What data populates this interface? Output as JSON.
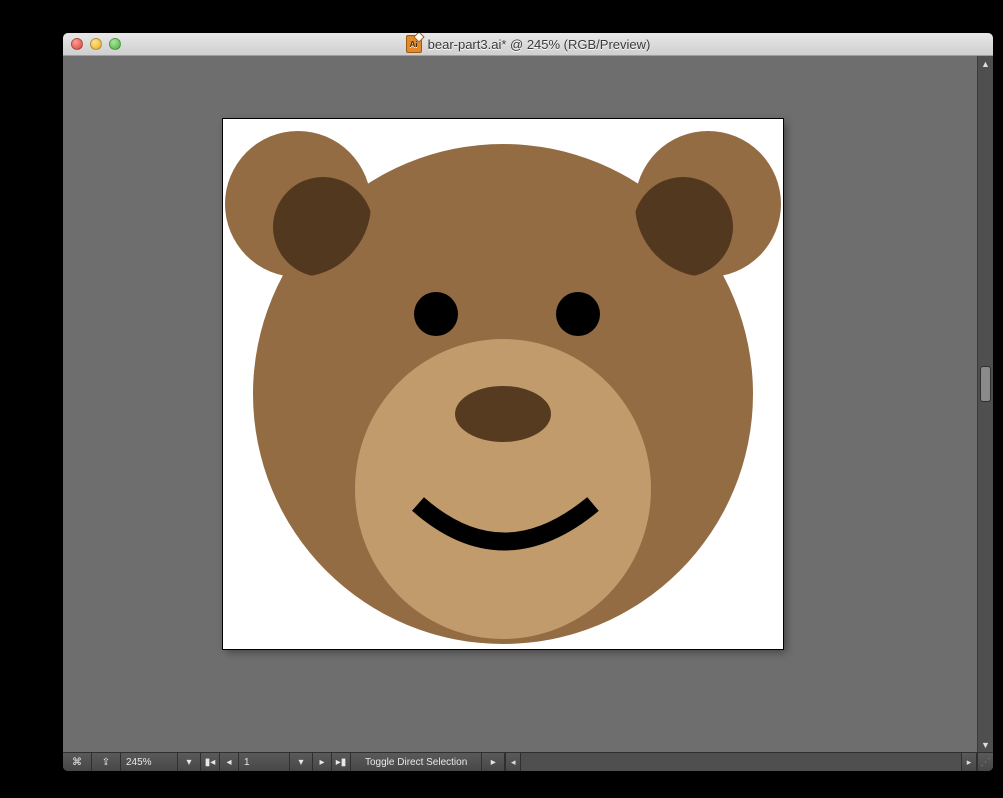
{
  "window": {
    "title": "bear-part3.ai* @ 245% (RGB/Preview)",
    "doc_icon": "ai-file-icon"
  },
  "statusbar": {
    "zoom": "245%",
    "artboard_number": "1",
    "tool_hint": "Toggle Direct Selection"
  },
  "artwork": {
    "colors": {
      "fur": "#946c43",
      "inner_ear": "#533820",
      "muzzle": "#c19b6c",
      "nose": "#563b21",
      "eye": "#000000",
      "mouth": "#000000"
    }
  }
}
